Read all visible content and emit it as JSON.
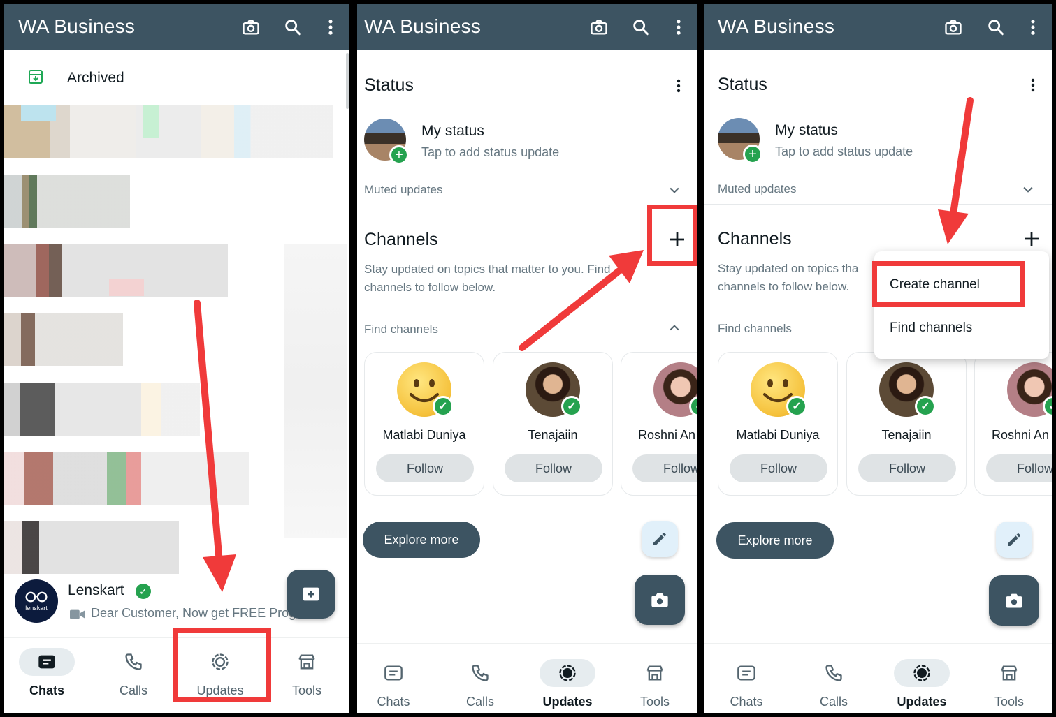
{
  "colors": {
    "header": "#3d5462",
    "accent": "#25a24f",
    "annotation_red": "#f03a3a",
    "follow_bg": "#dfe3e5"
  },
  "app": {
    "title": "WA Business"
  },
  "nav": {
    "chats": "Chats",
    "calls": "Calls",
    "updates": "Updates",
    "tools": "Tools"
  },
  "panel1": {
    "archived_label": "Archived",
    "chat": {
      "name": "Lenskart",
      "avatar_text": "lenskart",
      "preview": "Dear Customer, Now get FREE Prog"
    }
  },
  "updates": {
    "status_title": "Status",
    "my_status": "My status",
    "my_status_sub": "Tap to add status update",
    "muted_updates": "Muted updates",
    "channels_title": "Channels",
    "channels_desc_line1": "Stay updated on topics that matter to you. Find",
    "channels_desc_line2": "channels to follow below.",
    "channels_desc_line1_short": "Stay updated on topics tha",
    "find_channels": "Find channels",
    "explore_more": "Explore more",
    "follow": "Follow",
    "channels": [
      {
        "name": "Matlabi Duniya",
        "avatar": "smiley-emoji"
      },
      {
        "name": "Tenajaiin",
        "avatar": "portrait-photo"
      },
      {
        "name": "Roshni An",
        "avatar": "portrait-photo"
      }
    ]
  },
  "menu": {
    "create_channel": "Create channel",
    "find_channels": "Find channels"
  }
}
